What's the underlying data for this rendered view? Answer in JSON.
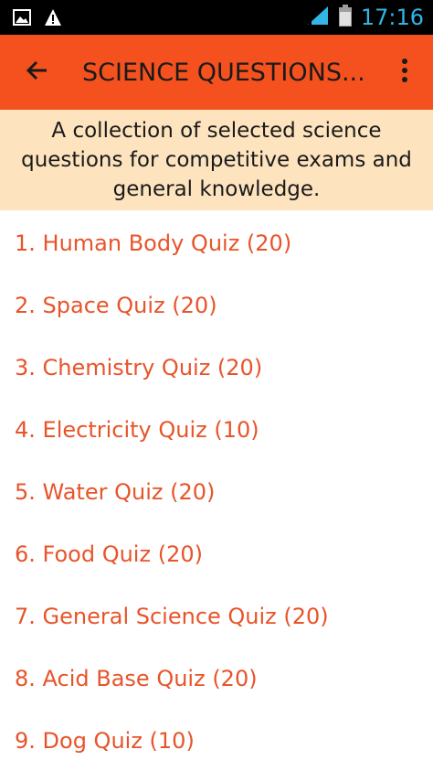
{
  "status_bar": {
    "time": "17:16",
    "icons": [
      "image-notification-icon",
      "warning-icon",
      "signal-icon",
      "battery-icon"
    ]
  },
  "app_bar": {
    "title": "SCIENCE QUESTIONS...",
    "back_icon": "arrow-back-icon",
    "menu_icon": "more-vert-icon",
    "color": "#f4511e"
  },
  "banner": {
    "text": "A collection of selected science questions for competitive exams and general knowledge.",
    "color": "#fde3be"
  },
  "quizzes": [
    {
      "label": "1. Human Body Quiz (20)"
    },
    {
      "label": "2. Space Quiz (20)"
    },
    {
      "label": "3. Chemistry Quiz (20)"
    },
    {
      "label": "4. Electricity Quiz (10)"
    },
    {
      "label": "5. Water Quiz (20)"
    },
    {
      "label": "6. Food Quiz (20)"
    },
    {
      "label": "7. General Science Quiz (20)"
    },
    {
      "label": "8. Acid Base Quiz (20)"
    },
    {
      "label": "9. Dog Quiz (10)"
    }
  ],
  "accent_text_color": "#e8542a"
}
